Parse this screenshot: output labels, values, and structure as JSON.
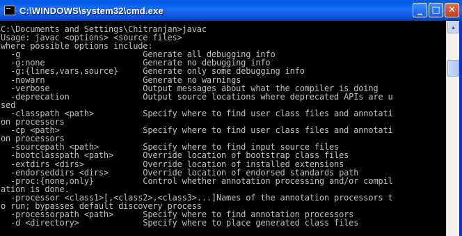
{
  "window": {
    "title": "C:\\WINDOWS\\system32\\cmd.exe",
    "buttons": {
      "minimize": "_",
      "maximize": "□",
      "close": "✕"
    }
  },
  "console": {
    "lines": [
      "C:\\Documents and Settings\\Chitranjan>javac",
      "Usage: javac <options> <source files>",
      "where possible options include:",
      "  -g                         Generate all debugging info",
      "  -g:none                    Generate no debugging info",
      "  -g:{lines,vars,source}     Generate only some debugging info",
      "  -nowarn                    Generate no warnings",
      "  -verbose                   Output messages about what the compiler is doing",
      "  -deprecation               Output source locations where deprecated APIs are u",
      "sed",
      "  -classpath <path>          Specify where to find user class files and annotati",
      "on processors",
      "  -cp <path>                 Specify where to find user class files and annotati",
      "on processors",
      "  -sourcepath <path>         Specify where to find input source files",
      "  -bootclasspath <path>      Override location of bootstrap class files",
      "  -extdirs <dirs>            Override location of installed extensions",
      "  -endorseddirs <dirs>       Override location of endorsed standards path",
      "  -proc:{none,only}          Control whether annotation processing and/or compil",
      "ation is done.",
      "  -processor <class1>[,<class2>,<class3>...]Names of the annotation processors t",
      "o run; bypasses default discovery process",
      "  -processorpath <path>      Specify where to find annotation processors",
      "  -d <directory>             Specify where to place generated class files"
    ]
  }
}
